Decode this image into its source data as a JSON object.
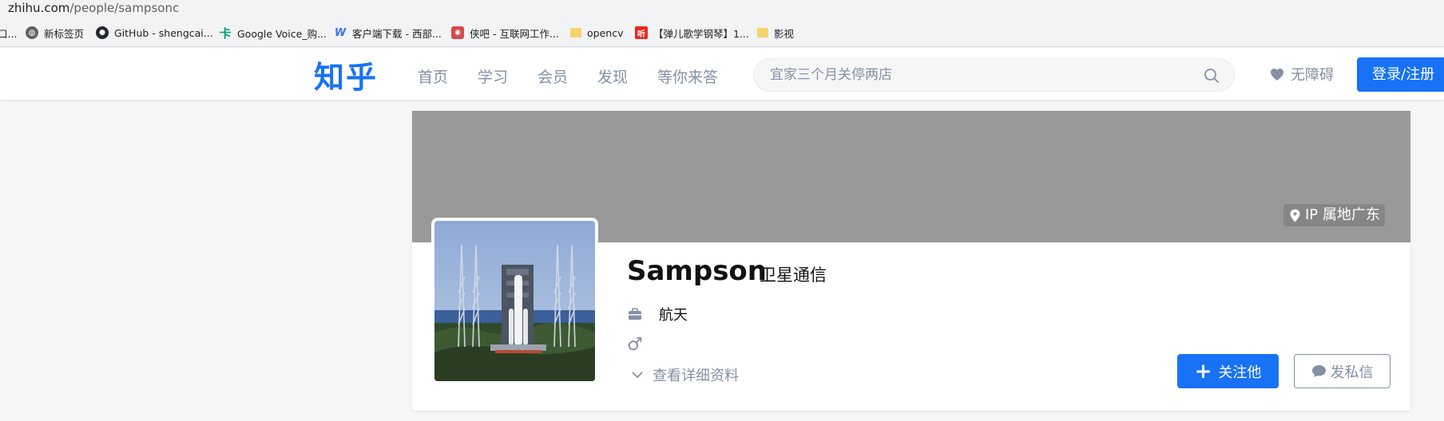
{
  "browser": {
    "url_host": "zhihu.com",
    "url_path": "/people/sampsonc"
  },
  "bookmarks": [
    {
      "label": "口...",
      "icon": "folder-cut-icon"
    },
    {
      "label": "新标签页",
      "icon": "globe-icon"
    },
    {
      "label": "GitHub - shengcai...",
      "icon": "github-icon"
    },
    {
      "label": "Google Voice_购...",
      "icon": "ka-icon"
    },
    {
      "label": "客户端下载 - 西部...",
      "icon": "w-icon"
    },
    {
      "label": "侠吧 - 互联网工作...",
      "icon": "xiaba-icon"
    },
    {
      "label": "opencv",
      "icon": "folder-icon"
    },
    {
      "label": "【弹儿歌学钢琴】1...",
      "icon": "ting-icon"
    },
    {
      "label": "影视",
      "icon": "folder-icon"
    }
  ],
  "header": {
    "logo": "知乎",
    "nav": [
      "首页",
      "学习",
      "会员",
      "发现",
      "等你来答"
    ],
    "search_placeholder": "宜家三个月关停两店",
    "accessibility": "无障碍",
    "login": "登录/注册"
  },
  "profile": {
    "ip_location": "IP 属地广东",
    "name": "Sampson",
    "headline": "卫星通信",
    "industry": "航天",
    "gender_symbol": "♂",
    "detail_link": "查看详细资料",
    "follow_button": "关注他",
    "message_button": "发私信"
  },
  "colors": {
    "brand": "#1772f6",
    "cover": "#999999",
    "muted": "#8590a6"
  }
}
